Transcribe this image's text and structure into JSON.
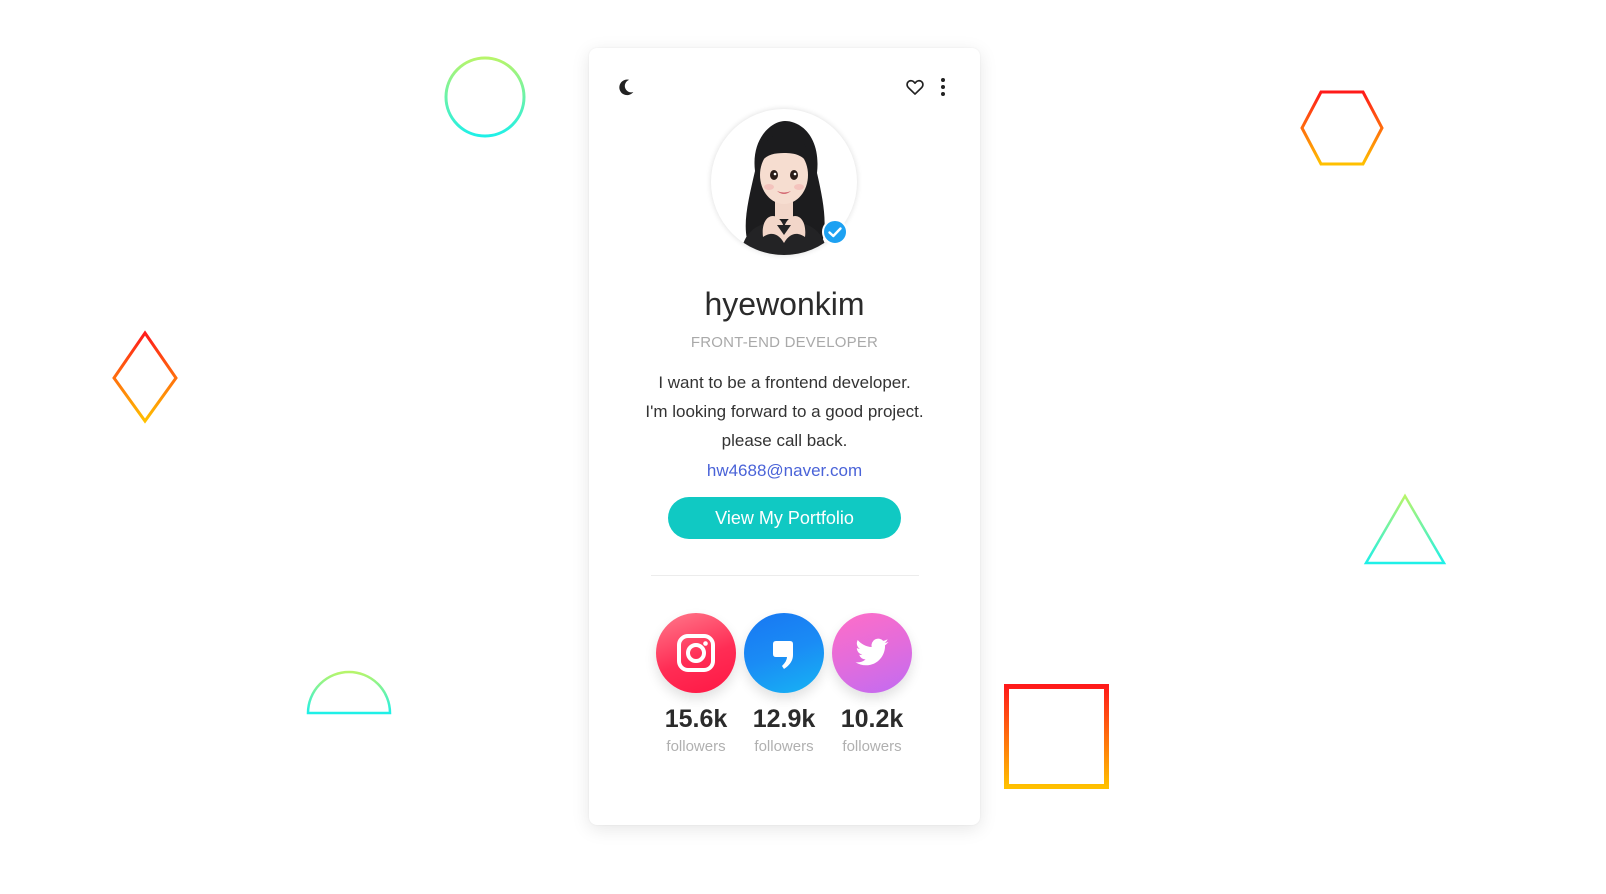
{
  "profile": {
    "username": "hyewonkim",
    "role": "FRONT-END DEVELOPER",
    "bio": "I want to be a frontend developer. I'm looking forward to a good project. please call back.",
    "email": "hw4688@naver.com",
    "portfolio_button": "View My Portfolio",
    "verified": true
  },
  "toolbar": {
    "icons": [
      "moon-icon",
      "heart-icon",
      "more-vertical-icon"
    ]
  },
  "socials": [
    {
      "network": "instagram",
      "icon": "instagram-icon",
      "count": "15.6k",
      "label": "followers"
    },
    {
      "network": "kakaotalk",
      "icon": "kakao-icon",
      "count": "12.9k",
      "label": "followers"
    },
    {
      "network": "twitter",
      "icon": "twitter-icon",
      "count": "10.2k",
      "label": "followers"
    }
  ],
  "colors": {
    "accent": "#10c9c3",
    "link": "#4a63d8",
    "instagram": "#ff2d55",
    "kakao": "#1a8cf5",
    "twitter": "#e36cdb",
    "verified": "#1da1f2"
  }
}
